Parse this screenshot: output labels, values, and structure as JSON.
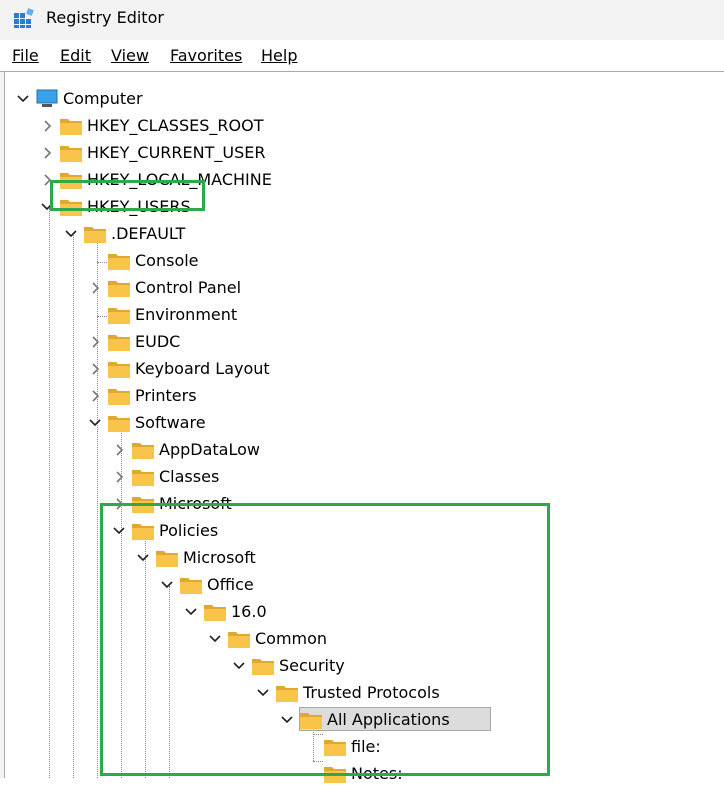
{
  "window": {
    "title": "Registry Editor",
    "app_icon": "registry-editor-icon"
  },
  "menu": [
    "File",
    "Edit",
    "View",
    "Favorites",
    "Help"
  ],
  "tree": {
    "root": "Computer",
    "hives": [
      "HKEY_CLASSES_ROOT",
      "HKEY_CURRENT_USER",
      "HKEY_LOCAL_MACHINE",
      "HKEY_USERS"
    ],
    "default_key": ".DEFAULT",
    "default_children": [
      "Console",
      "Control Panel",
      "Environment",
      "EUDC",
      "Keyboard Layout",
      "Printers",
      "Software"
    ],
    "software_children": [
      "AppDataLow",
      "Classes",
      "Microsoft",
      "Policies"
    ],
    "policies_path": [
      "Microsoft",
      "Office",
      "16.0",
      "Common",
      "Security",
      "Trusted Protocols",
      "All Applications"
    ],
    "all_apps_children": [
      "file:",
      "Notes:"
    ],
    "selected_key": "All Applications"
  },
  "colors": {
    "highlight_border": "#2ea84b",
    "folder": "#f8c54a",
    "selection": "#dcdcdc"
  },
  "icons": {
    "expanded": "chevron-down-icon",
    "collapsed": "chevron-right-icon",
    "folder": "folder-icon",
    "computer": "computer-icon"
  }
}
